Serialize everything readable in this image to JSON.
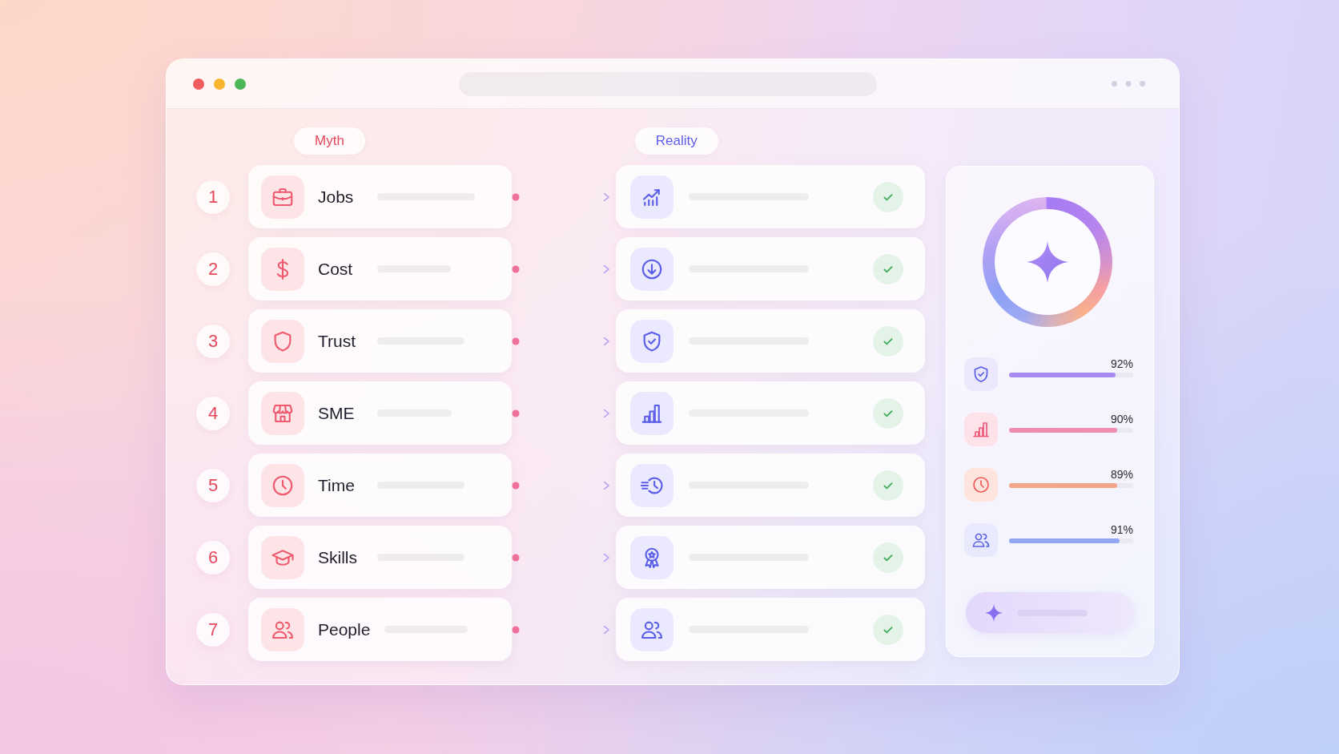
{
  "headers": [
    {
      "kind": "myth",
      "label": "Myth"
    },
    {
      "kind": "reality",
      "label": "Reality"
    }
  ],
  "rows": [
    {
      "number": "1",
      "myth": "Jobs",
      "verified": true
    },
    {
      "number": "2",
      "myth": "Cost",
      "verified": true
    },
    {
      "number": "3",
      "myth": "Trust",
      "verified": true
    },
    {
      "number": "4",
      "myth": "SME",
      "verified": true
    },
    {
      "number": "5",
      "myth": "Time",
      "verified": true
    },
    {
      "number": "6",
      "myth": "Skills",
      "verified": true
    },
    {
      "number": "7",
      "myth": "People",
      "verified": true
    }
  ],
  "metrics": [
    {
      "value": "92%",
      "level": 0.86,
      "color": "#a98af3"
    },
    {
      "value": "90%",
      "level": 0.87,
      "color": "#ee8db0"
    },
    {
      "value": "89%",
      "level": 0.87,
      "color": "#f6a688"
    },
    {
      "value": "91%",
      "level": 0.89,
      "color": "#92a6f4"
    }
  ]
}
